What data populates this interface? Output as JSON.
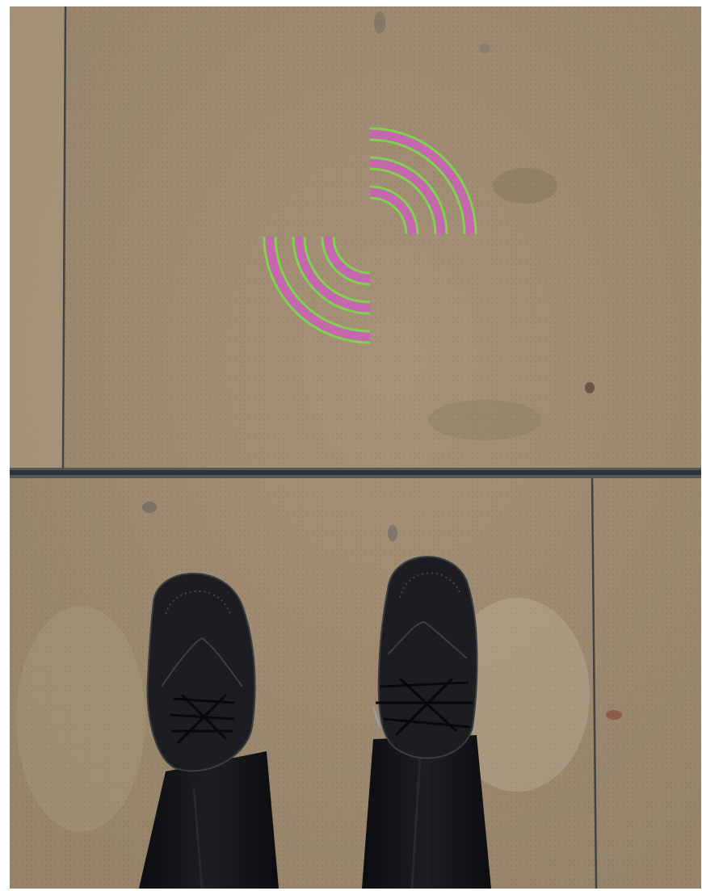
{
  "scene": {
    "description_tag": "photo",
    "floor_color": "#a38f74",
    "seam_color": "#3f4346",
    "dark_seam_color": "#2b2f33",
    "stain_color": "#8a7b66",
    "light_patch_color": "#c6b8a2"
  },
  "graphic": {
    "icon": "wireless-signal-arcs-icon",
    "arc_color": "#c567ac",
    "outline_color": "#7fd24f",
    "arc_count_per_group": 3,
    "groups": 2
  },
  "subject": {
    "icon": "shoes-icon",
    "shoe_color": "#1b1d20",
    "trouser_color": "#101113",
    "lace_color": "#07080a"
  }
}
